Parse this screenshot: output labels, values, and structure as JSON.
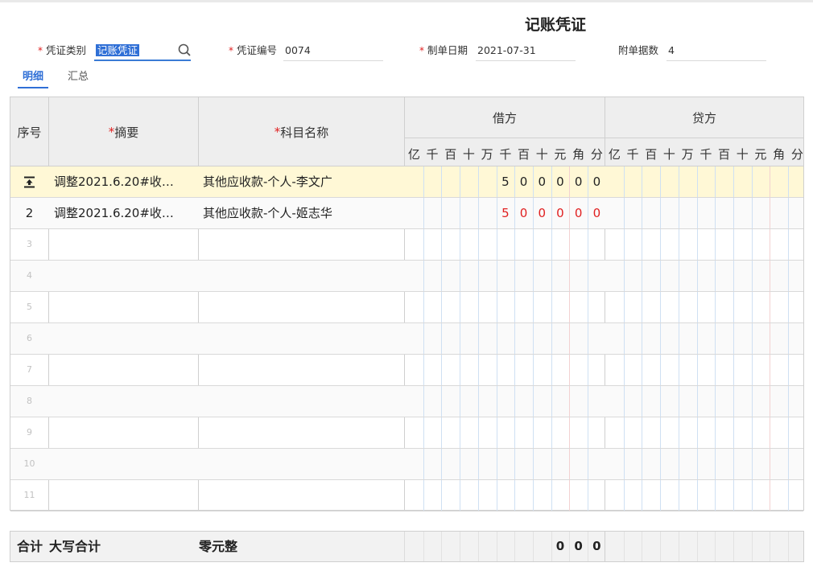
{
  "voucher": {
    "title": "记账凭证",
    "type_label": "凭证类别",
    "type_value": "记账凭证",
    "number_label": "凭证编号",
    "number_value": "0074",
    "date_label": "制单日期",
    "date_value": "2021-07-31",
    "attachments_label": "附单据数",
    "attachments_value": "4",
    "required_mark": "*"
  },
  "tabs": [
    {
      "label": "明细",
      "active": true
    },
    {
      "label": "汇总",
      "active": false
    }
  ],
  "table": {
    "headers": {
      "seq": "序号",
      "summary": "摘要",
      "account": "科目名称",
      "debit": "借方",
      "credit": "贷方"
    },
    "digit_units": [
      "亿",
      "千",
      "百",
      "十",
      "万",
      "千",
      "百",
      "十",
      "元",
      "角",
      "分"
    ],
    "rows": [
      {
        "seq": "",
        "insert_icon": "insert-row-icon",
        "summary": "调整2021.6.20#收…",
        "account": "其他应收款-个人-李文广",
        "debit_digits": [
          "5",
          "0",
          "0",
          "0",
          "0",
          "0"
        ],
        "debit_color": "#222222",
        "highlighted": true
      },
      {
        "seq": "2",
        "summary": "调整2021.6.20#收…",
        "account": "其他应收款-个人-姬志华",
        "debit_digits": [
          "5",
          "0",
          "0",
          "0",
          "0",
          "0"
        ],
        "debit_color": "#e02020",
        "highlighted": false
      },
      {
        "seq": "3",
        "summary": "",
        "account": "",
        "debit_digits": [],
        "highlighted": false
      },
      {
        "seq": "4",
        "summary": "",
        "account": "",
        "debit_digits": [],
        "highlighted": false
      },
      {
        "seq": "5",
        "summary": "",
        "account": "",
        "debit_digits": [],
        "highlighted": false
      },
      {
        "seq": "6",
        "summary": "",
        "account": "",
        "debit_digits": [],
        "highlighted": false
      },
      {
        "seq": "7",
        "summary": "",
        "account": "",
        "debit_digits": [],
        "highlighted": false
      },
      {
        "seq": "8",
        "summary": "",
        "account": "",
        "debit_digits": [],
        "highlighted": false
      },
      {
        "seq": "9",
        "summary": "",
        "account": "",
        "debit_digits": [],
        "highlighted": false
      },
      {
        "seq": "10",
        "summary": "",
        "account": "",
        "debit_digits": [],
        "highlighted": false
      },
      {
        "seq": "11",
        "summary": "",
        "account": "",
        "debit_digits": [],
        "highlighted": false
      }
    ]
  },
  "totals": {
    "label": "合计",
    "uppercase_label": "大写合计",
    "uppercase_value": "零元整",
    "debit_digits": [
      "0",
      "0",
      "0"
    ]
  },
  "colors": {
    "accent": "#2f6fd6",
    "required": "#e02020",
    "highlight_row": "#fff8d6",
    "header_bg": "#eeeeee",
    "digit_line_blue": "#cfe0f3",
    "digit_line_red": "#f3d1d1"
  }
}
